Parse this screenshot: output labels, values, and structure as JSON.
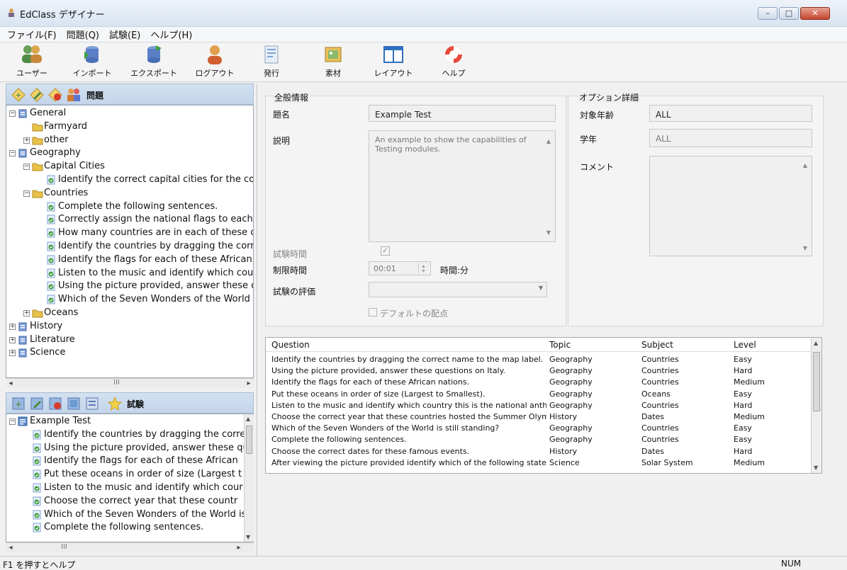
{
  "window": {
    "title": "EdClass デザイナー",
    "minimize": "–",
    "maximize": "□",
    "close": "✕"
  },
  "menu": [
    "ファイル(F)",
    "問題(Q)",
    "試験(E)",
    "ヘルプ(H)"
  ],
  "toolbar": [
    {
      "label": "ユーザー",
      "icon": "users-icon"
    },
    {
      "label": "インポート",
      "icon": "import-icon"
    },
    {
      "label": "エクスポート",
      "icon": "export-icon"
    },
    {
      "label": "ログアウト",
      "icon": "logout-icon"
    },
    {
      "label": "発行",
      "icon": "publish-icon"
    },
    {
      "label": "素材",
      "icon": "material-icon"
    },
    {
      "label": "レイアウト",
      "icon": "layout-icon"
    },
    {
      "label": "ヘルプ",
      "icon": "help-icon"
    }
  ],
  "questions_panel": {
    "title": "問題",
    "tree": [
      {
        "text": "General",
        "level": 0,
        "kind": "db",
        "expander": "−"
      },
      {
        "text": "Farmyard",
        "level": 1,
        "kind": "folder"
      },
      {
        "text": "other",
        "level": 1,
        "kind": "folder",
        "expander": "+"
      },
      {
        "text": "Geography",
        "level": 0,
        "kind": "db",
        "expander": "−"
      },
      {
        "text": "Capital Cities",
        "level": 1,
        "kind": "folder",
        "expander": "−"
      },
      {
        "text": "Identify the correct capital cities for the co",
        "level": 2,
        "kind": "doc"
      },
      {
        "text": "Countries",
        "level": 1,
        "kind": "folder",
        "expander": "−"
      },
      {
        "text": "Complete the following sentences.",
        "level": 2,
        "kind": "doc"
      },
      {
        "text": "Correctly assign the national flags to each",
        "level": 2,
        "kind": "doc"
      },
      {
        "text": "How many countries are in each of these c",
        "level": 2,
        "kind": "doc"
      },
      {
        "text": "Identify the countries by dragging the corre",
        "level": 2,
        "kind": "doc"
      },
      {
        "text": "Identify the flags for each of these African",
        "level": 2,
        "kind": "doc"
      },
      {
        "text": "Listen to the music and identify which cour",
        "level": 2,
        "kind": "doc"
      },
      {
        "text": "Using the picture provided, answer these q",
        "level": 2,
        "kind": "doc"
      },
      {
        "text": "Which of the Seven Wonders of the World is",
        "level": 2,
        "kind": "doc"
      },
      {
        "text": "Oceans",
        "level": 1,
        "kind": "folder",
        "expander": "+"
      },
      {
        "text": "History",
        "level": 0,
        "kind": "db",
        "expander": "+"
      },
      {
        "text": "Literature",
        "level": 0,
        "kind": "db",
        "expander": "+"
      },
      {
        "text": "Science",
        "level": 0,
        "kind": "db",
        "expander": "+"
      }
    ],
    "scroll_mark": "III"
  },
  "exam_panel": {
    "title": "試験",
    "tree": [
      {
        "text": "Example Test",
        "level": 0,
        "kind": "exam",
        "expander": "−"
      },
      {
        "text": "Identify the countries by dragging the corre",
        "level": 1,
        "kind": "doc"
      },
      {
        "text": "Using the picture provided, answer these qu",
        "level": 1,
        "kind": "doc"
      },
      {
        "text": "Identify the flags for each of these African",
        "level": 1,
        "kind": "doc"
      },
      {
        "text": "Put these oceans in order of size (Largest t",
        "level": 1,
        "kind": "doc"
      },
      {
        "text": "Listen to the music and identify which cour",
        "level": 1,
        "kind": "doc"
      },
      {
        "text": "Choose the correct year that these countr",
        "level": 1,
        "kind": "doc"
      },
      {
        "text": "Which of the Seven Wonders of the World is",
        "level": 1,
        "kind": "doc"
      },
      {
        "text": "Complete the following sentences.",
        "level": 1,
        "kind": "doc"
      }
    ],
    "scroll_mark": "III"
  },
  "general": {
    "title": "全般情報",
    "name_label": "題名",
    "name_value": "Example Test",
    "desc_label": "説明",
    "desc_value": "An example to show the capabilities of Testing modules.",
    "exam_time_label": "試験時間",
    "exam_time_checked": "✓",
    "limit_label": "制限時間",
    "limit_value": "00:01",
    "limit_unit": "時間:分",
    "grading_label": "試験の評価",
    "grading_value": "",
    "default_score_label": "デフォルトの配点"
  },
  "options": {
    "title": "オプション詳細",
    "age_label": "対象年齢",
    "age_value": "ALL",
    "grade_label": "学年",
    "grade_value": "ALL",
    "comment_label": "コメント",
    "comment_value": ""
  },
  "grid": {
    "columns": [
      "Question",
      "Topic",
      "Subject",
      "Level"
    ],
    "rows": [
      [
        "Identify the countries by dragging the correct name to the map label.",
        "Geography",
        "Countries",
        "Easy"
      ],
      [
        "Using the picture provided, answer these questions on Italy.",
        "Geography",
        "Countries",
        "Hard"
      ],
      [
        "Identify the flags for each of these African nations.",
        "Geography",
        "Countries",
        "Medium"
      ],
      [
        "Put these oceans in order of size (Largest to Smallest).",
        "Geography",
        "Oceans",
        "Easy"
      ],
      [
        "Listen to the music and identify which country this is the national anth...",
        "Geography",
        "Countries",
        "Hard"
      ],
      [
        "Choose the correct year that these countries hosted the Summer Olym...",
        "History",
        "Dates",
        "Medium"
      ],
      [
        "Which of the Seven Wonders of the World is still standing?",
        "Geography",
        "Countries",
        "Easy"
      ],
      [
        "Complete the following sentences.",
        "Geography",
        "Countries",
        "Easy"
      ],
      [
        "Choose the correct dates for these famous events.",
        "History",
        "Dates",
        "Hard"
      ],
      [
        "After viewing the picture provided identify which of the following state...",
        "Science",
        "Solar System",
        "Medium"
      ]
    ]
  },
  "status": {
    "help": "F1 を押すとヘルプ",
    "num": "NUM"
  },
  "colors": {
    "folder": "#e8c24a",
    "db": "#5b7fc7",
    "doc": "#3c8a3c",
    "panel_header": "#c9d9ee"
  }
}
